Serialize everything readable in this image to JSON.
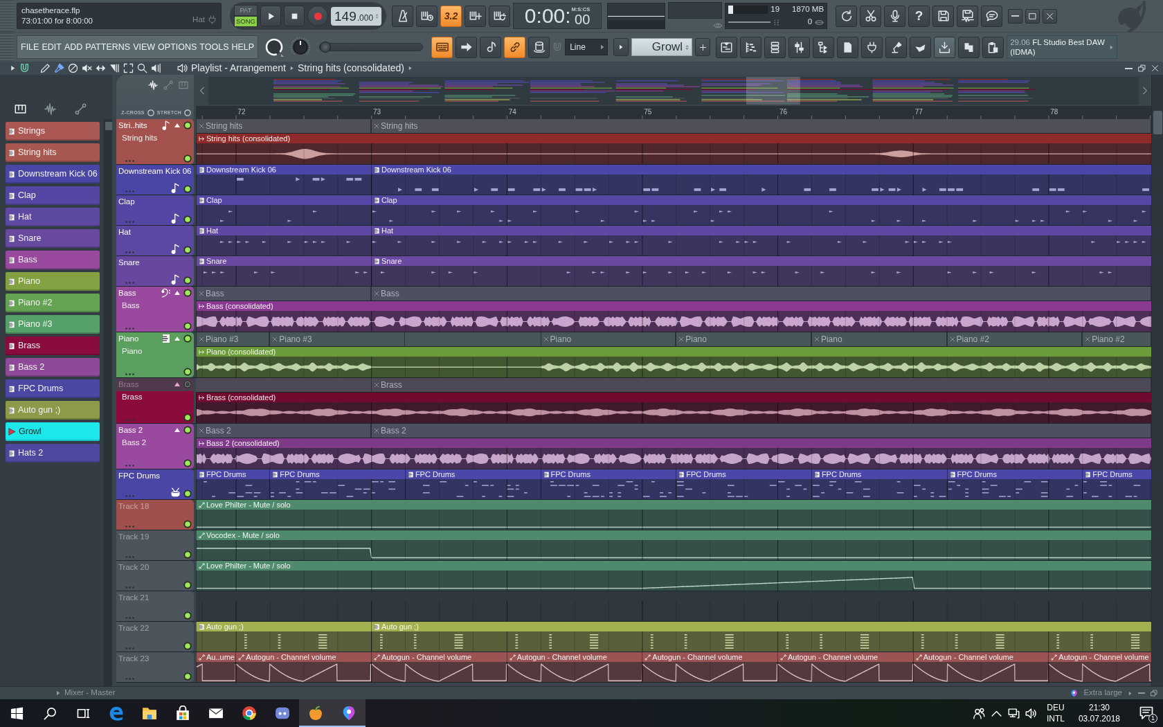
{
  "header": {
    "file": "chasetherace.flp",
    "hint": "73:01:00 for 8:00:00",
    "hint_target": "Hat"
  },
  "transport": {
    "modes": [
      {
        "label": "PAT",
        "selected": false
      },
      {
        "label": "SONG",
        "selected": true
      }
    ],
    "tempo": {
      "whole": "149",
      "fraction": ".000"
    }
  },
  "record_options": [
    {
      "on": false
    },
    {
      "on": false
    },
    {
      "on": true,
      "label": "3.2"
    },
    {
      "on": false
    },
    {
      "on": false
    }
  ],
  "time": {
    "main": "0:00:",
    "centiseconds": "00",
    "format": "M:S:CS"
  },
  "monitor": {
    "cpu_meter": {
      "level": 0.12
    },
    "cpu": "19",
    "memory": "1870 MB",
    "polyphony": "0"
  },
  "utilities": {
    "help_label": "?"
  },
  "menu": [
    "FILE",
    "EDIT",
    "ADD",
    "PATTERNS",
    "VIEW",
    "OPTIONS",
    "TOOLS",
    "HELP"
  ],
  "pitch_slider": {
    "level": 0
  },
  "mode_toggles": [
    {
      "on": true
    },
    {
      "on": false
    },
    {
      "on": false
    },
    {
      "on": true
    },
    {
      "on": false
    }
  ],
  "snap": {
    "value": "Line"
  },
  "pattern": {
    "value": "Growl"
  },
  "window_buttons": [
    {
      "on": false
    },
    {
      "on": false
    },
    {
      "on": false
    },
    {
      "on": false
    },
    {
      "on": false
    },
    {
      "on": false
    },
    {
      "on": false
    },
    {
      "on": false
    },
    {
      "on": false
    },
    {
      "on": true
    },
    {
      "on": false
    },
    {
      "on": false
    }
  ],
  "news": {
    "date": "29.06",
    "headline": "FL Studio Best DAW (IDMA)"
  },
  "playlist": {
    "magnet": {
      "on": true
    },
    "tools": [
      {
        "selected": false
      },
      {
        "selected": true
      },
      {
        "selected": false
      },
      {
        "selected": false
      },
      {
        "selected": false
      },
      {
        "selected": false
      },
      {
        "selected": false
      },
      {
        "selected": false
      },
      {
        "selected": false
      }
    ],
    "title": "Playlist - Arrangement",
    "crumb": "String hits (consolidated)",
    "lane_filters": [
      {
        "selected": true
      },
      {
        "selected": false
      },
      {
        "selected": false
      }
    ],
    "track_filters": [
      {
        "selected": true
      },
      {
        "selected": false
      },
      {
        "selected": false
      }
    ],
    "options": [
      {
        "label": "Z-CROSS",
        "checked": false
      },
      {
        "label": "STRETCH",
        "checked": false
      }
    ],
    "ruler": [
      "72",
      "73",
      "74",
      "75",
      "76",
      "77",
      "78"
    ]
  },
  "channels": [
    {
      "name": "Strings",
      "color": "#ab5753",
      "selected": false
    },
    {
      "name": "String hits",
      "color": "#a8584f",
      "selected": false
    },
    {
      "name": "Downstream Kick 06",
      "color": "#4a46a6",
      "selected": false
    },
    {
      "name": "Clap",
      "color": "#5347a3",
      "selected": false
    },
    {
      "name": "Hat",
      "color": "#5d48a2",
      "selected": false
    },
    {
      "name": "Snare",
      "color": "#67499f",
      "selected": false
    },
    {
      "name": "Bass",
      "color": "#9a4a9e",
      "selected": false
    },
    {
      "name": "Piano",
      "color": "#82a242",
      "selected": false
    },
    {
      "name": "Piano #2",
      "color": "#64a352",
      "selected": false
    },
    {
      "name": "Piano #3",
      "color": "#56a06a",
      "selected": false
    },
    {
      "name": "Brass",
      "color": "#8a0b3e",
      "selected": false
    },
    {
      "name": "Bass 2",
      "color": "#8e4a98",
      "selected": false
    },
    {
      "name": "FPC Drums",
      "color": "#4a48a2",
      "selected": false
    },
    {
      "name": "Auto gun ;)",
      "color": "#8c9a4a",
      "selected": false
    },
    {
      "name": "Growl",
      "color": "#1ce8ec",
      "selected": true
    },
    {
      "name": "Hats 2",
      "color": "#4f48a0",
      "selected": false
    }
  ],
  "tracks": [
    {
      "name": "Stri..hits",
      "color": "#a3524e",
      "kind": "sampler",
      "muted": false,
      "unnamed": false,
      "clips": [
        {
          "label": "String hits",
          "kind": "ghost"
        },
        {
          "label": "String hits",
          "kind": "ghost"
        }
      ],
      "subtrack": {
        "name": "String hits",
        "muted": false,
        "clips": [
          {
            "label": "String hits (consolidated)",
            "kind": "audio",
            "color": "#8e2a2a"
          }
        ]
      }
    },
    {
      "name": "Downstream Kick 06",
      "color": "#4a46a6",
      "kind": "sampler",
      "muted": false,
      "unnamed": false,
      "clips": [
        {
          "label": "Downstream Kick 06",
          "kind": "pattern",
          "color": "#4a47a8"
        },
        {
          "label": "Downstream Kick 06",
          "kind": "pattern",
          "color": "#4a47a8"
        }
      ]
    },
    {
      "name": "Clap",
      "color": "#5347a3",
      "kind": "sampler",
      "muted": false,
      "unnamed": false,
      "clips": [
        {
          "label": "Clap",
          "kind": "pattern",
          "color": "#5547a6"
        },
        {
          "label": "Clap",
          "kind": "pattern",
          "color": "#5547a6"
        }
      ]
    },
    {
      "name": "Hat",
      "color": "#5c48a2",
      "kind": "sampler",
      "muted": false,
      "unnamed": false,
      "clips": [
        {
          "label": "Hat",
          "kind": "pattern",
          "color": "#5e48a4"
        },
        {
          "label": "Hat",
          "kind": "pattern",
          "color": "#5e48a4"
        }
      ]
    },
    {
      "name": "Snare",
      "color": "#66499f",
      "kind": "sampler",
      "muted": false,
      "unnamed": false,
      "clips": [
        {
          "label": "Snare",
          "kind": "pattern",
          "color": "#6a4aa0"
        },
        {
          "label": "Snare",
          "kind": "pattern",
          "color": "#6a4aa0"
        }
      ]
    },
    {
      "name": "Bass",
      "color": "#9a4a9e",
      "kind": "bass",
      "muted": false,
      "unnamed": false,
      "clips": [
        {
          "label": "Bass",
          "kind": "ghost"
        },
        {
          "label": "Bass",
          "kind": "ghost"
        }
      ],
      "subtrack": {
        "name": "Bass",
        "muted": false,
        "clips": [
          {
            "label": "Bass (consolidated)",
            "kind": "audio",
            "color": "#8a3a90"
          }
        ]
      }
    },
    {
      "name": "Piano",
      "color": "#5a9f5e",
      "kind": "keys",
      "muted": false,
      "unnamed": false,
      "clips": [
        {
          "label": "Piano #3",
          "kind": "ghost"
        },
        {
          "label": "Piano #3",
          "kind": "ghost"
        },
        {
          "label": "Piano",
          "kind": "ghost"
        },
        {
          "label": "Piano",
          "kind": "ghost"
        },
        {
          "label": "Piano",
          "kind": "ghost"
        },
        {
          "label": "Piano #2",
          "kind": "ghost"
        },
        {
          "label": "Piano #2",
          "kind": "ghost"
        }
      ],
      "subtrack": {
        "name": "Piano",
        "muted": false,
        "clips": [
          {
            "label": "Piano (consolidated)",
            "kind": "audio",
            "color": "#6c9b3a"
          }
        ]
      }
    },
    {
      "name": "Brass",
      "color": "#8a0b3c",
      "kind": "plain",
      "muted": true,
      "unnamed": false,
      "clips": [
        {
          "label": "Brass",
          "kind": "ghost"
        }
      ],
      "subtrack": {
        "name": "Brass",
        "muted": false,
        "clips": [
          {
            "label": "Brass (consolidated)",
            "kind": "audio",
            "color": "#700a2e"
          }
        ]
      }
    },
    {
      "name": "Bass 2",
      "color": "#9a4a9e",
      "kind": "plain",
      "muted": false,
      "unnamed": false,
      "clips": [
        {
          "label": "Bass 2",
          "kind": "ghost"
        },
        {
          "label": "Bass 2",
          "kind": "ghost"
        }
      ],
      "subtrack": {
        "name": "Bass 2",
        "muted": false,
        "clips": [
          {
            "label": "Bass 2 (consolidated)",
            "kind": "audio",
            "color": "#7e3a88"
          }
        ]
      }
    },
    {
      "name": "FPC Drums",
      "color": "#4a46a6",
      "kind": "drums",
      "muted": false,
      "unnamed": false,
      "clips": [
        {
          "label": "FPC Drums",
          "kind": "pattern",
          "color": "#4a47a8"
        },
        {
          "label": "FPC Drums",
          "kind": "pattern",
          "color": "#4a47a8"
        },
        {
          "label": "FPC Drums",
          "kind": "pattern",
          "color": "#4a47a8"
        },
        {
          "label": "FPC Drums",
          "kind": "pattern",
          "color": "#4a47a8"
        },
        {
          "label": "FPC Drums",
          "kind": "pattern",
          "color": "#4a47a8"
        },
        {
          "label": "FPC Drums",
          "kind": "pattern",
          "color": "#4a47a8"
        },
        {
          "label": "FPC Drums",
          "kind": "pattern",
          "color": "#4a47a8"
        },
        {
          "label": "FPC Drums",
          "kind": "pattern",
          "color": "#4a47a8"
        }
      ]
    },
    {
      "name": "Track 18",
      "color": "#a0504c",
      "kind": "plain",
      "muted": false,
      "unnamed": true,
      "clips": [
        {
          "label": "Love Philter - Mute / solo",
          "kind": "automation",
          "color": "#4f8a6d"
        }
      ]
    },
    {
      "name": "Track 19",
      "color": "#4b555b",
      "kind": "plain",
      "muted": false,
      "unnamed": true,
      "clips": [
        {
          "label": "Vocodex - Mute / solo",
          "kind": "automation",
          "color": "#4f8a6d"
        }
      ]
    },
    {
      "name": "Track 20",
      "color": "#4b555b",
      "kind": "plain",
      "muted": false,
      "unnamed": true,
      "clips": [
        {
          "label": "Love Philter - Mute / solo",
          "kind": "automation",
          "color": "#4f8a6d"
        }
      ]
    },
    {
      "name": "Track 21",
      "color": "#4b555b",
      "kind": "plain",
      "muted": false,
      "unnamed": true
    },
    {
      "name": "Track 22",
      "color": "#4b555b",
      "kind": "plain",
      "muted": false,
      "unnamed": true,
      "clips": [
        {
          "label": "Auto gun ;)",
          "kind": "pattern",
          "color": "#a3b04f"
        },
        {
          "label": "Auto gun ;)",
          "kind": "pattern",
          "color": "#a3b04f"
        }
      ]
    },
    {
      "name": "Track 23",
      "color": "#4b555b",
      "kind": "plain",
      "muted": false,
      "unnamed": true,
      "clips": [
        {
          "label": "Au..ume",
          "kind": "automation",
          "color": "#9c5353"
        },
        {
          "label": "Autogun - Channel volume",
          "kind": "automation",
          "color": "#9c5353"
        },
        {
          "label": "Autogun - Channel volume",
          "kind": "automation",
          "color": "#9c5353"
        },
        {
          "label": "Autogun - Channel volume",
          "kind": "automation",
          "color": "#9c5353"
        },
        {
          "label": "Autogun - Channel volume",
          "kind": "automation",
          "color": "#9c5353"
        },
        {
          "label": "Autogun - Channel volume",
          "kind": "automation",
          "color": "#9c5353"
        },
        {
          "label": "Autogun - Channel volume",
          "kind": "automation",
          "color": "#9c5353"
        },
        {
          "label": "Autogun - Channel volume",
          "kind": "automation",
          "color": "#9c5353"
        }
      ]
    }
  ],
  "mixer_bar": {
    "title": "Mixer - Master",
    "preset": "Extra large"
  },
  "taskbar": {
    "apps": [
      {
        "active": false
      },
      {
        "active": false
      },
      {
        "active": false
      },
      {
        "active": false
      },
      {
        "active": false
      },
      {
        "active": false
      },
      {
        "active": true
      },
      {
        "active": true
      }
    ],
    "language": "DEU",
    "layout": "INTL",
    "time": "21:30",
    "date": "03.07.2018",
    "notifications": "1"
  }
}
